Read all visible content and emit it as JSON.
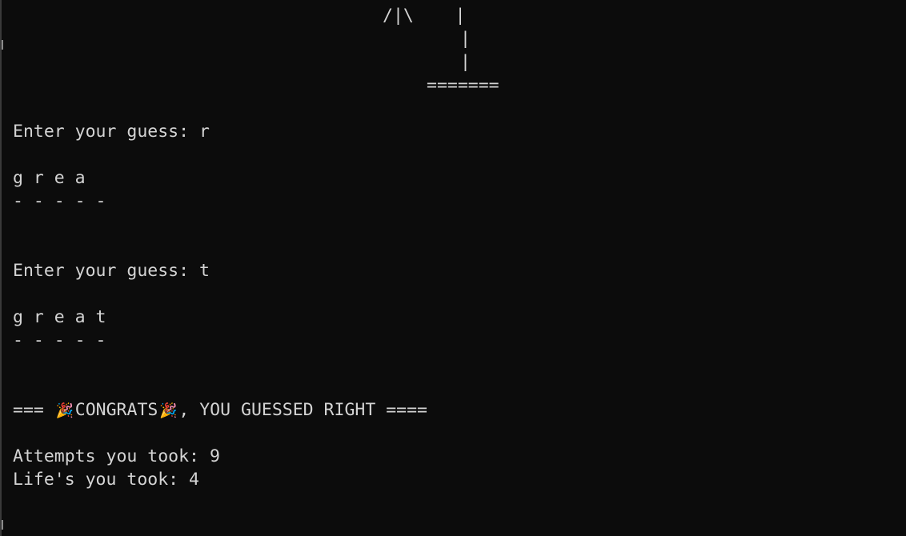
{
  "terminal": {
    "gallows": {
      "arms_line": "/|\\    |",
      "post_line_1": "|",
      "post_line_2": "|",
      "base_line": "======="
    },
    "round1": {
      "prompt": "Enter your guess: r",
      "revealed": "g r e a",
      "slots": "- - - - -"
    },
    "round2": {
      "prompt": "Enter your guess: t",
      "revealed": "g r e a t",
      "slots": "- - - - -"
    },
    "result": {
      "prefix": "=== ",
      "icon": "party-popper-icon",
      "glyph": "🎉",
      "congrats": "CONGRATS",
      "suffix": ", YOU GUESSED RIGHT ====",
      "attempts": "Attempts you took: 9",
      "lives": "Life's you took: 4"
    }
  }
}
